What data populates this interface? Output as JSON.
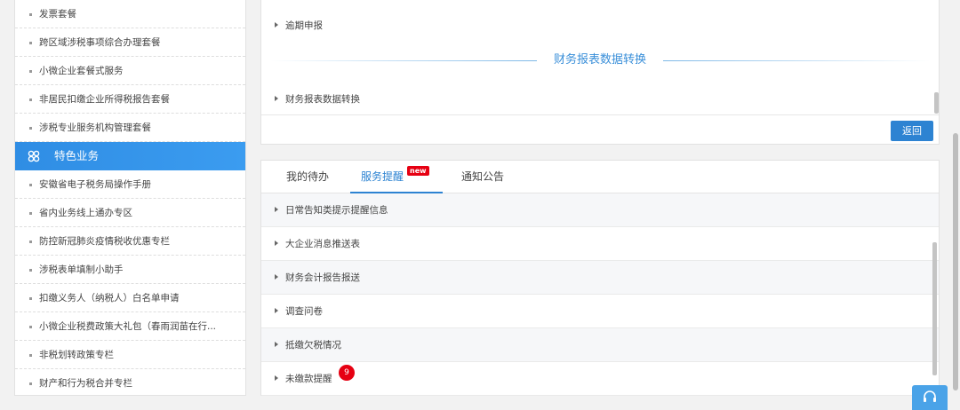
{
  "sidebar": {
    "items_top": [
      {
        "label": "发票套餐"
      },
      {
        "label": "跨区域涉税事项综合办理套餐"
      },
      {
        "label": "小微企业套餐式服务"
      },
      {
        "label": "非居民扣缴企业所得税报告套餐"
      },
      {
        "label": "涉税专业服务机构管理套餐"
      }
    ],
    "section_label": "特色业务",
    "items_bottom": [
      {
        "label": "安徽省电子税务局操作手册"
      },
      {
        "label": "省内业务线上通办专区"
      },
      {
        "label": "防控新冠肺炎疫情税收优惠专栏"
      },
      {
        "label": "涉税表单填制小助手"
      },
      {
        "label": "扣缴义务人（纳税人）白名单申请"
      },
      {
        "label": "小微企业税费政策大礼包（春雨润苗在行..."
      },
      {
        "label": "非税划转政策专栏"
      },
      {
        "label": "财产和行为税合并专栏"
      }
    ]
  },
  "top_panel": {
    "row1": "逾期申报",
    "section_title": "财务报表数据转换",
    "row2": "财务报表数据转换",
    "back_label": "返回"
  },
  "bottom_panel": {
    "tabs": [
      {
        "label": "我的待办"
      },
      {
        "label": "服务提醒"
      },
      {
        "label": "通知公告"
      }
    ],
    "new_badge": "new",
    "reminders": [
      {
        "label": "日常告知类提示提醒信息"
      },
      {
        "label": "大企业消息推送表"
      },
      {
        "label": "财务会计报告报送"
      },
      {
        "label": "调查问卷"
      },
      {
        "label": "抵缴欠税情况"
      },
      {
        "label": "未缴款提醒",
        "count": "9"
      }
    ]
  },
  "colors": {
    "accent": "#2d83d2",
    "badge": "#e60012"
  }
}
